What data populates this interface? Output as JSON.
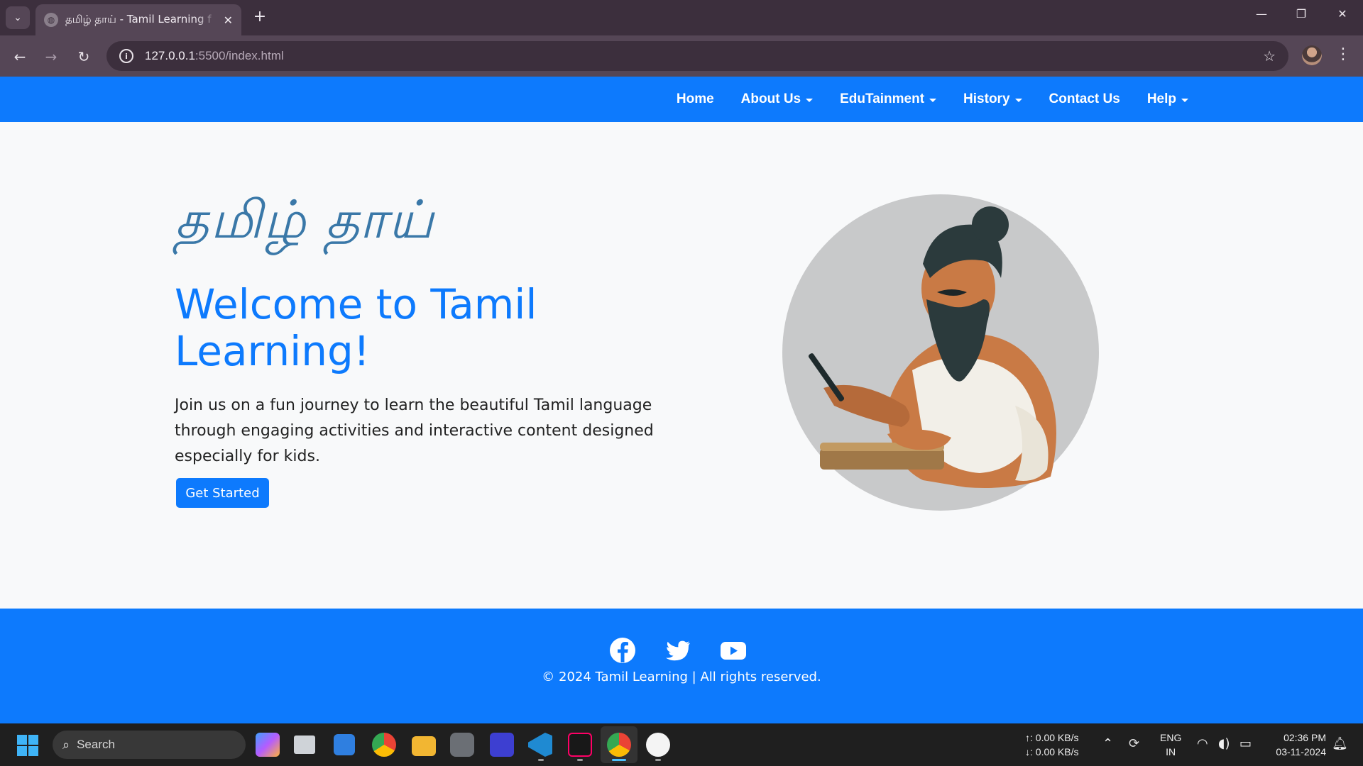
{
  "browser": {
    "tab_title": "தமிழ் தாய் - Tamil Learning f",
    "url_host": "127.0.0.1",
    "url_path": ":5500/index.html"
  },
  "nav": {
    "items": [
      {
        "label": "Home",
        "dropdown": false
      },
      {
        "label": "About Us",
        "dropdown": true
      },
      {
        "label": "EduTainment",
        "dropdown": true
      },
      {
        "label": "History",
        "dropdown": true
      },
      {
        "label": "Contact Us",
        "dropdown": false
      },
      {
        "label": "Help",
        "dropdown": true
      }
    ]
  },
  "hero": {
    "tamil_title": "தமிழ் தாய்",
    "title": "Welcome to Tamil Learning!",
    "text": "Join us on a fun journey to learn the beautiful Tamil language through engaging activities and interactive content designed especially for kids.",
    "button": "Get Started"
  },
  "footer": {
    "social": [
      "facebook-icon",
      "twitter-icon",
      "youtube-icon"
    ],
    "copyright": "© 2024 Tamil Learning | All rights reserved."
  },
  "taskbar": {
    "search_label": "Search",
    "upload_speed": "↑: 0.00 KB/s",
    "download_speed": "↓: 0.00 KB/s",
    "lang_top": "ENG",
    "lang_bottom": "IN",
    "time": "02:36 PM",
    "date": "03-11-2024"
  },
  "colors": {
    "primary": "#0d7afd",
    "chrome_dark": "#3c2f3d",
    "chrome_light": "#554656",
    "tamil_script": "#3a78a8"
  }
}
